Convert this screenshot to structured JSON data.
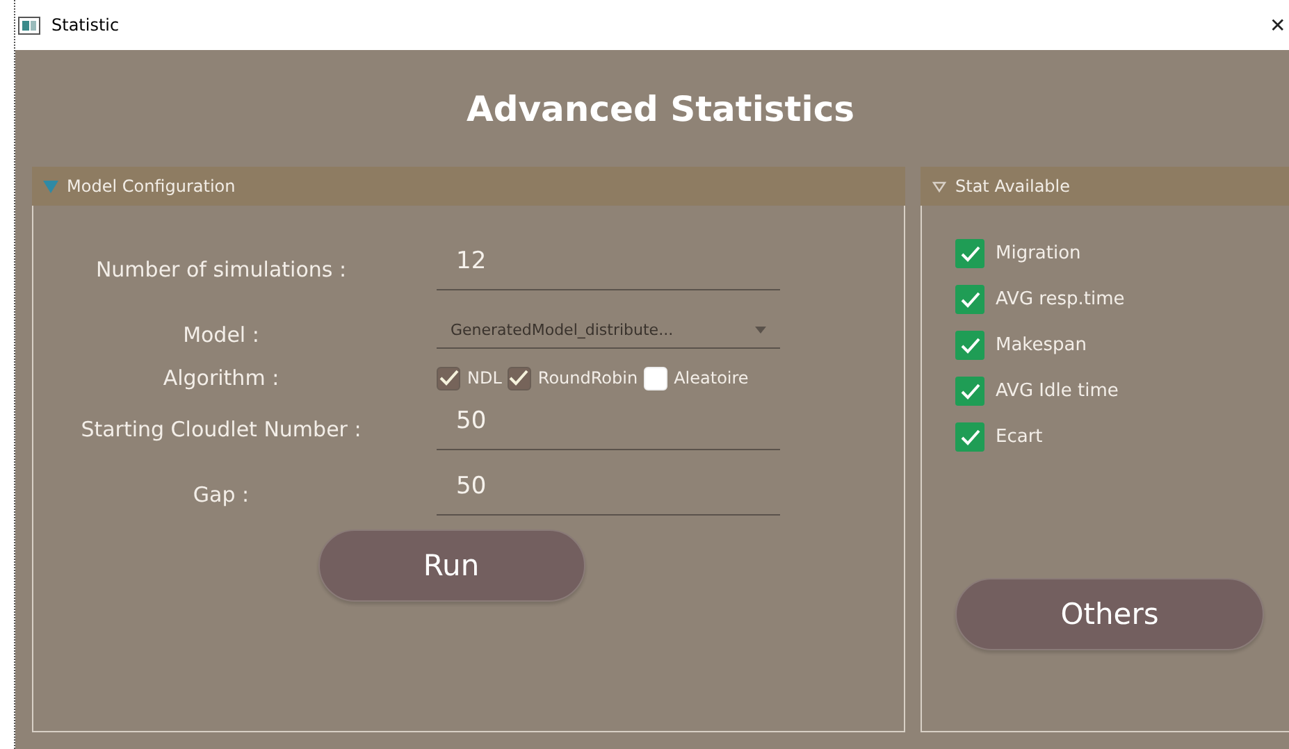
{
  "window": {
    "title": "Statistic",
    "close": "✕"
  },
  "heading": "Advanced Statistics",
  "model_panel": {
    "title": "Model Configuration",
    "expanded": true,
    "fields": [
      {
        "kind": "text",
        "label": "Number of simulations  :",
        "value": "12"
      },
      {
        "kind": "dropdown",
        "label": "Model  :",
        "value": "GeneratedModel_distribute..."
      },
      {
        "kind": "checks",
        "label": "Algorithm  :",
        "options": [
          {
            "label": "NDL",
            "checked": true
          },
          {
            "label": "RoundRobin",
            "checked": true
          },
          {
            "label": "Aleatoire",
            "checked": false
          }
        ]
      },
      {
        "kind": "text",
        "label": "Starting Cloudlet Number :",
        "value": "50"
      },
      {
        "kind": "text",
        "label": "Gap   :",
        "value": "50"
      }
    ],
    "button": "Run"
  },
  "stat_panel": {
    "title": "Stat Available",
    "expanded": true,
    "items": [
      {
        "label": "Migration",
        "checked": true
      },
      {
        "label": "AVG resp.time",
        "checked": true
      },
      {
        "label": "Makespan",
        "checked": true
      },
      {
        "label": "AVG Idle time",
        "checked": true
      },
      {
        "label": "Ecart",
        "checked": true
      }
    ],
    "button": "Others"
  }
}
